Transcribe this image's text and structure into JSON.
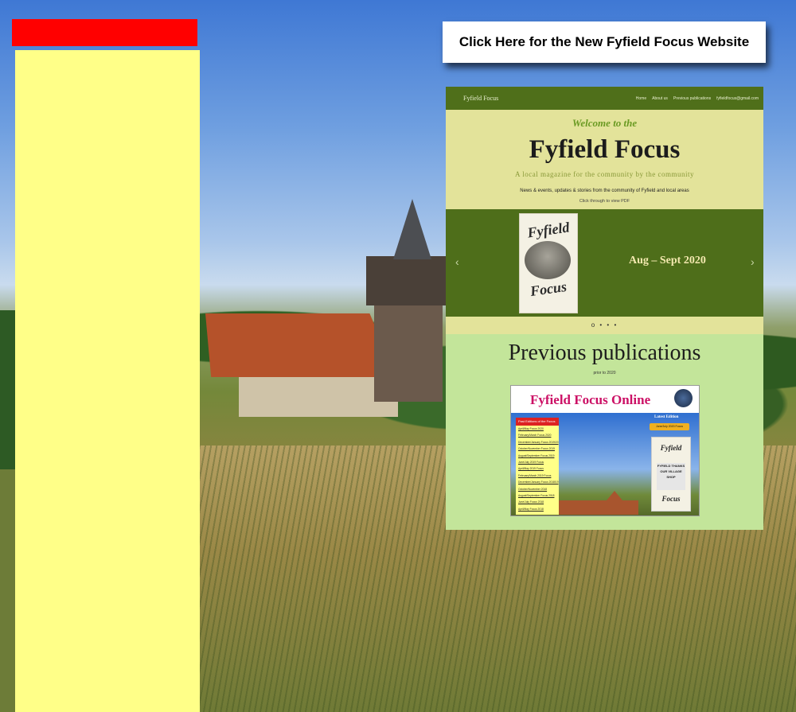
{
  "page": {
    "new_site_button_label": "Click Here for the New Fyfield Focus Website"
  },
  "preview": {
    "nav": {
      "brand": "Fyfield Focus",
      "links": [
        "Home",
        "About us",
        "Previous publications",
        "fyfieldfocus@gmail.com"
      ]
    },
    "hero": {
      "welcome": "Welcome to the",
      "title": "Fyfield Focus",
      "tagline": "A local magazine for the community by the community",
      "description": "News & events, updates & stories from the community of Fyfield and local areas",
      "click_note": "Click through to view PDF"
    },
    "slider": {
      "cover_word_top": "Fyfield",
      "cover_word_bottom": "Focus",
      "issue_label": "Aug – Sept 2020",
      "prev_arrow": "‹",
      "next_arrow": "›",
      "dots": "o • • •"
    },
    "previous": {
      "title": "Previous publications",
      "subtitle": "prior to 2020",
      "thumb_title": "Fyfield Focus Online",
      "thumb_list_heading": "Past Editions of the Focus",
      "thumb_list_items": [
        "April/May Focus 2020",
        "February/March Focus 2020",
        "December/January Focus 2019/20",
        "October/November Focus 2019",
        "August/September Focus 2019",
        "June/July 2019 Focus",
        "April/May 2019 Focus",
        "February/March 2019 Focus",
        "December/January Focus 2018/19",
        "October/November 2018",
        "August/September Focus 2018",
        "June/July Focus 2018",
        "April/May Focus 2018"
      ],
      "thumb_latest": "Latest Edition",
      "thumb_latest_button": "June/July 2020 Focus",
      "thumb_cover_top": "Fyfield",
      "thumb_cover_mid": "FYFIELD THANKS OUR VILLAGE SHOP",
      "thumb_cover_bottom": "Focus"
    }
  },
  "colors": {
    "red_bar": "#ff0000",
    "yellow_panel": "#ffff88",
    "nav_green": "#4f6f1a",
    "hero_cream": "#e3e39a",
    "prev_green": "#c3e59a"
  }
}
